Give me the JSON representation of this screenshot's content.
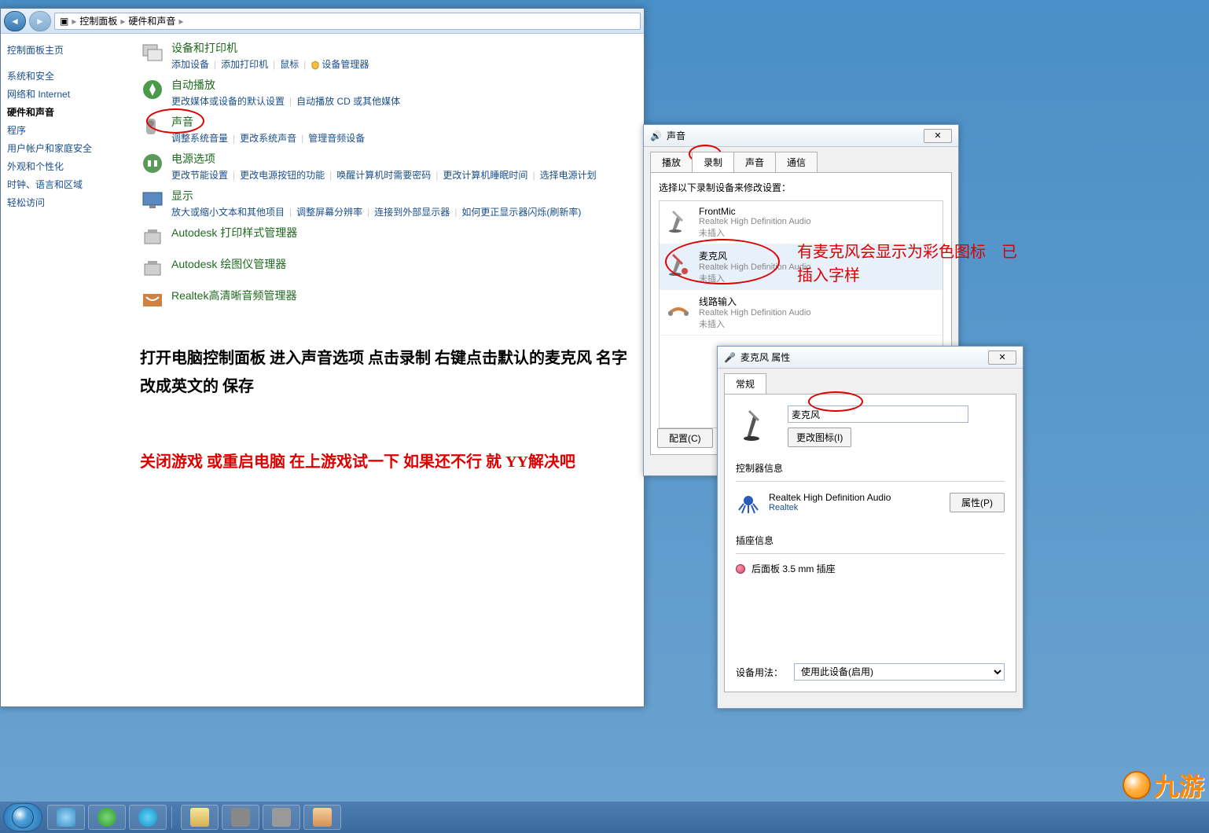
{
  "breadcrumb": {
    "root_icon": "⊞",
    "a": "控制面板",
    "b": "硬件和声音"
  },
  "sidebar": {
    "home": "控制面板主页",
    "items": [
      {
        "label": "系统和安全"
      },
      {
        "label": "网络和 Internet"
      },
      {
        "label": "硬件和声音",
        "active": true
      },
      {
        "label": "程序"
      },
      {
        "label": "用户帐户和家庭安全"
      },
      {
        "label": "外观和个性化"
      },
      {
        "label": "时钟、语言和区域"
      },
      {
        "label": "轻松访问"
      }
    ]
  },
  "categories": [
    {
      "title": "设备和打印机",
      "links": [
        "添加设备",
        "添加打印机",
        "鼠标",
        "设备管理器"
      ],
      "shield_at": [
        3
      ]
    },
    {
      "title": "自动播放",
      "links": [
        "更改媒体或设备的默认设置",
        "自动播放 CD 或其他媒体"
      ]
    },
    {
      "title": "声音",
      "links": [
        "调整系统音量",
        "更改系统声音",
        "管理音频设备"
      ],
      "oval": true
    },
    {
      "title": "电源选项",
      "links": [
        "更改节能设置",
        "更改电源按钮的功能",
        "唤醒计算机时需要密码",
        "更改计算机睡眠时间",
        "选择电源计划"
      ]
    },
    {
      "title": "显示",
      "links": [
        "放大或缩小文本和其他项目",
        "调整屏幕分辨率",
        "连接到外部显示器",
        "如何更正显示器闪烁(刷新率)"
      ]
    },
    {
      "title": "Autodesk 打印样式管理器",
      "links": []
    },
    {
      "title": "Autodesk 绘图仪管理器",
      "links": []
    },
    {
      "title": "Realtek高清晰音频管理器",
      "links": []
    }
  ],
  "instruction1": "打开电脑控制面板 进入声音选项 点击录制 右键点击默认的麦克风 名字改成英文的 保存",
  "instruction2": "关闭游戏 或重启电脑 在上游戏试一下 如果还不行 就 YY解决吧",
  "sound_dialog": {
    "title": "声音",
    "tabs": [
      "播放",
      "录制",
      "声音",
      "通信"
    ],
    "active_tab": 1,
    "instr": "选择以下录制设备来修改设置：",
    "devices": [
      {
        "name": "FrontMic",
        "desc": "Realtek High Definition Audio",
        "status": "未插入"
      },
      {
        "name": "麦克风",
        "desc": "Realtek High Definition Audio",
        "status": "未插入",
        "selected": true
      },
      {
        "name": "线路输入",
        "desc": "Realtek High Definition Audio",
        "status": "未插入"
      }
    ],
    "config_btn": "配置(C)",
    "close_x": "✕"
  },
  "mic_dialog": {
    "title": "麦克风 属性",
    "tab": "常规",
    "name_value": "麦克风",
    "change_icon": "更改图标(I)",
    "ctrl_section": "控制器信息",
    "ctrl_name": "Realtek High Definition Audio",
    "ctrl_vendor": "Realtek",
    "props_btn": "属性(P)",
    "jack_section": "插座信息",
    "jack_label": "后面板 3.5 mm 插座",
    "usage_label": "设备用法：",
    "usage_value": "使用此设备(启用)",
    "close_x": "✕"
  },
  "annotations": {
    "mic_note": "有麦克风会显示为彩色图标　已插入字样"
  },
  "watermark": "九游"
}
